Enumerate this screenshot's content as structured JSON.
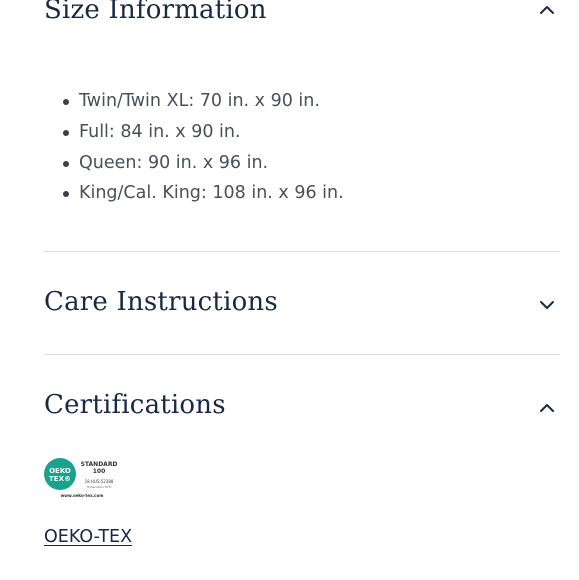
{
  "sections": {
    "size": {
      "title": "Size Information",
      "expanded": true,
      "items": [
        "Twin/Twin XL: 70 in. x 90 in.",
        "Full: 84 in. x 90 in.",
        "Queen: 90 in. x 96 in.",
        "King/Cal. King: 108 in. x 96 in."
      ]
    },
    "care": {
      "title": "Care Instructions",
      "expanded": false
    },
    "certifications": {
      "title": "Certifications",
      "expanded": true,
      "badge": {
        "icon": "oeko-tex-logo",
        "circle_text_1": "OEKO",
        "circle_text_2": "TEX®",
        "standard": "STANDARD",
        "number": "100",
        "code": "18.HUS.52388",
        "institute": "Hohenstein HTTI",
        "url": "www.oeko-tex.com"
      },
      "link_label": "OEKO-TEX"
    }
  },
  "colors": {
    "heading": "#1b2845",
    "body_text": "#4a4f5a",
    "divider": "#dcdcdc",
    "oeko_green": "#1aa38c"
  },
  "icons": {
    "collapse": "chevron-up-icon",
    "expand": "chevron-down-icon"
  }
}
